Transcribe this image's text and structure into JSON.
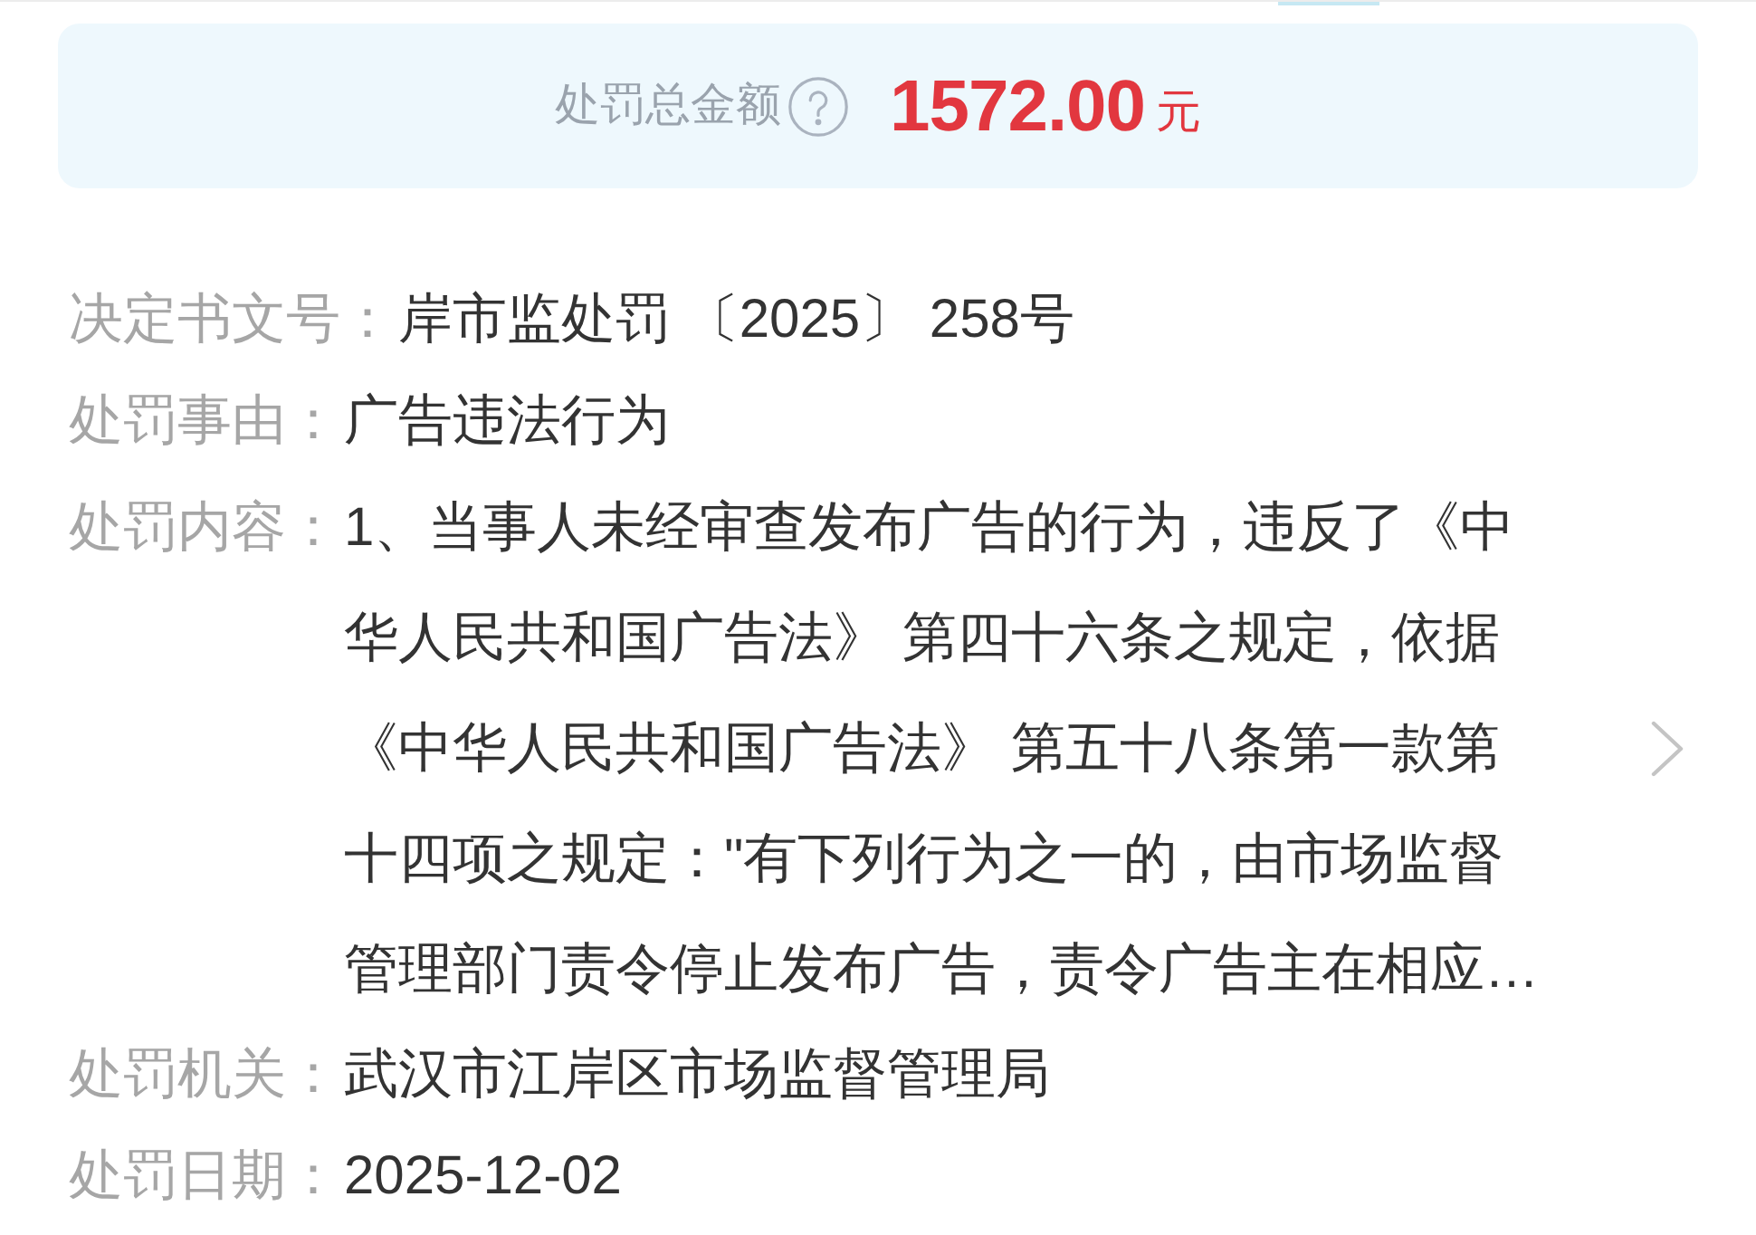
{
  "total_penalty": {
    "label": "处罚总金额",
    "amount": "1572.00",
    "unit": "元"
  },
  "details": [
    {
      "kind": "plain",
      "label": "决定书文号：",
      "value": "岸市监处罚 〔2025〕 258号"
    },
    {
      "kind": "plain",
      "label": "处罚事由：",
      "value": "广告违法行为"
    },
    {
      "kind": "expandable",
      "label": "处罚内容：",
      "value": "1、当事人未经审查发布广告的行为，违反了《中华人民共和国广告法》 第四十六条之规定，依据《中华人民共和国广告法》 第五十八条第一款第十四项之规定：\"有下列行为之一的，由市场监督管理部门责令停止发布广告，责令广告主在相应…"
    },
    {
      "kind": "plain",
      "label": "处罚机关：",
      "value": "武汉市江岸区市场监督管理局"
    },
    {
      "kind": "plain",
      "label": "处罚日期：",
      "value": "2025-12-02"
    }
  ]
}
